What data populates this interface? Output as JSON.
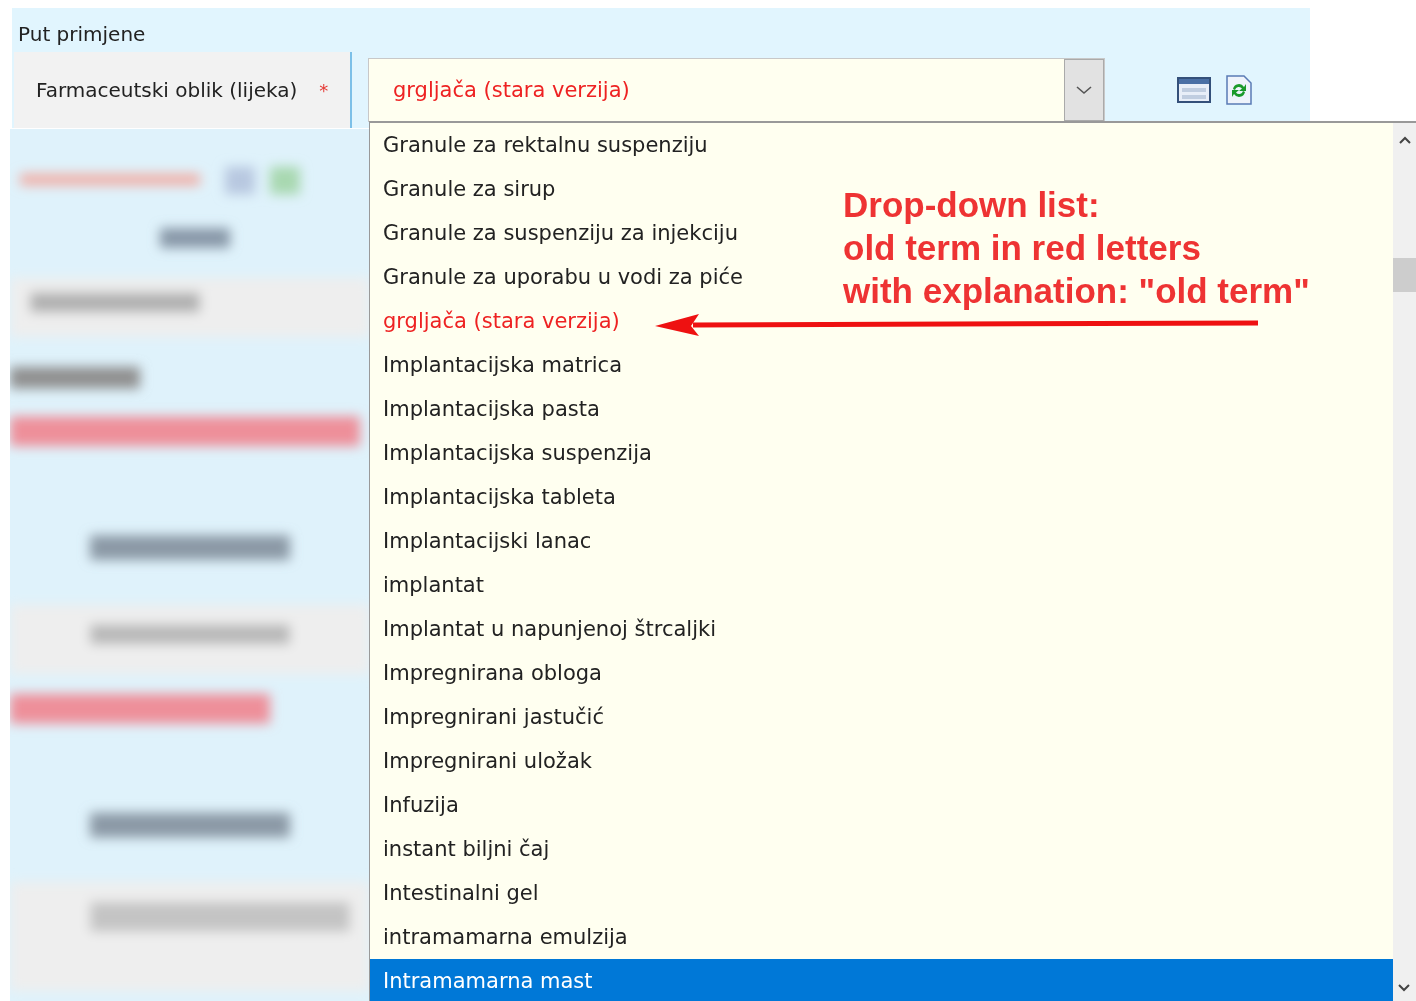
{
  "section": {
    "title": "Put primjene"
  },
  "field": {
    "label": "Farmaceutski oblik (lijeka)",
    "required_mark": "*",
    "value": "grgljača (stara verzija)",
    "value_old": true
  },
  "dropdown": {
    "items": [
      {
        "label": "Granule za rektalnu suspenziju",
        "old": false,
        "selected": false
      },
      {
        "label": "Granule za sirup",
        "old": false,
        "selected": false
      },
      {
        "label": "Granule za suspenziju za injekciju",
        "old": false,
        "selected": false
      },
      {
        "label": "Granule za uporabu u vodi za piće",
        "old": false,
        "selected": false
      },
      {
        "label": "grgljača (stara verzija)",
        "old": true,
        "selected": false
      },
      {
        "label": "Implantacijska matrica",
        "old": false,
        "selected": false
      },
      {
        "label": "Implantacijska pasta",
        "old": false,
        "selected": false
      },
      {
        "label": "Implantacijska suspenzija",
        "old": false,
        "selected": false
      },
      {
        "label": "Implantacijska tableta",
        "old": false,
        "selected": false
      },
      {
        "label": "Implantacijski lanac",
        "old": false,
        "selected": false
      },
      {
        "label": "implantat",
        "old": false,
        "selected": false
      },
      {
        "label": "Implantat u napunjenoj štrcaljki",
        "old": false,
        "selected": false
      },
      {
        "label": "Impregnirana obloga",
        "old": false,
        "selected": false
      },
      {
        "label": "Impregnirani jastučić",
        "old": false,
        "selected": false
      },
      {
        "label": "Impregnirani uložak",
        "old": false,
        "selected": false
      },
      {
        "label": "Infuzija",
        "old": false,
        "selected": false
      },
      {
        "label": "instant biljni čaj",
        "old": false,
        "selected": false
      },
      {
        "label": "Intestinalni gel",
        "old": false,
        "selected": false
      },
      {
        "label": "intramamarna emulzija",
        "old": false,
        "selected": false
      },
      {
        "label": "Intramamarna mast",
        "old": false,
        "selected": true
      }
    ]
  },
  "annotation": {
    "lines": [
      "Drop-down list:",
      "old term in red letters",
      "with explanation: \"old term\""
    ]
  }
}
